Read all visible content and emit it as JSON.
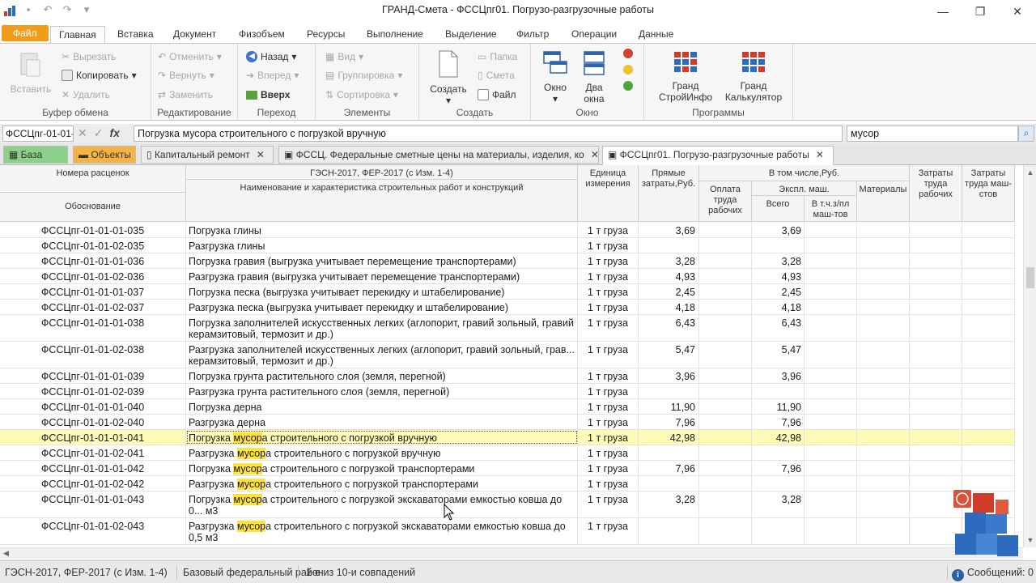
{
  "app": {
    "title": "ГРАНД-Смета - ФССЦпг01. Погрузо-разгрузочные работы",
    "window_controls": [
      "minimize",
      "maximize",
      "close"
    ]
  },
  "ribbon_tabs": [
    "Файл",
    "Главная",
    "Вставка",
    "Документ",
    "Физобъем",
    "Ресурсы",
    "Выполнение",
    "Выделение",
    "Фильтр",
    "Операции",
    "Данные"
  ],
  "ribbon": {
    "clipboard": {
      "title": "Буфер обмена",
      "paste": "Вставить",
      "cut": "Вырезать",
      "copy": "Копировать",
      "delete": "Удалить"
    },
    "editing": {
      "title": "Редактирование",
      "undo": "Отменить",
      "redo": "Вернуть",
      "replace": "Заменить"
    },
    "navigation": {
      "title": "Переход",
      "back": "Назад",
      "forward": "Вперед",
      "up": "Вверх"
    },
    "elements": {
      "title": "Элементы",
      "view": "Вид",
      "grouping": "Группировка",
      "sorting": "Сортировка"
    },
    "create": {
      "title": "Создать",
      "create": "Создать",
      "folder": "Папка",
      "estimate": "Смета",
      "file": "Файл"
    },
    "window": {
      "title": "Окно",
      "window": "Окно",
      "two_windows_line1": "Два",
      "two_windows_line2": "окна"
    },
    "programs": {
      "title": "Программы",
      "grand_stroyinfo_line1": "Гранд",
      "grand_stroyinfo_line2": "СтройИнфо",
      "grand_calc_line1": "Гранд",
      "grand_calc_line2": "Калькулятор"
    }
  },
  "formula_bar": {
    "name_box": "ФССЦпг-01-01-",
    "content": "Погрузка мусора строительного с погрузкой вручную",
    "search": "мусор"
  },
  "doc_tabs": {
    "base": "База",
    "objects": "Объекты",
    "capital_repair": "Капитальный ремонт",
    "fssc": "ФССЦ. Федеральные сметные цены на материалы, изделия, ко",
    "active": "ФССЦпг01. Погрузо-разгрузочные работы"
  },
  "grid": {
    "headers": {
      "code_top": "Номера расценок",
      "code_bottom": "Обоснование",
      "name_top": "ГЭСН-2017, ФЕР-2017 (с Изм. 1-4)",
      "name_bottom": "Наименование и характеристика строительных работ и конструкций",
      "unit": "Единица измерения",
      "direct": "Прямые затраты,Руб.",
      "incl": "В том числе,Руб.",
      "labor_pay": "Оплата труда рабочих",
      "mach": "Экспл. маш.",
      "mach_total": "Всего",
      "mach_incl": "В т.ч.з/пл маш-тов",
      "materials": "Материалы",
      "labor_workers": "Затраты труда рабочих",
      "labor_machinists": "Затраты труда маш-стов"
    },
    "highlight_term": "мусор",
    "rows": [
      {
        "code": "ФССЦпг-01-01-01-035",
        "name": "Погрузка глины",
        "unit": "1 т груза",
        "direct": "3,69",
        "mach": "3,69"
      },
      {
        "code": "ФССЦпг-01-01-02-035",
        "name": "Разгрузка глины",
        "unit": "1 т груза",
        "direct": "",
        "mach": ""
      },
      {
        "code": "ФССЦпг-01-01-01-036",
        "name": "Погрузка гравия (выгрузка учитывает перемещение транспортерами)",
        "unit": "1 т груза",
        "direct": "3,28",
        "mach": "3,28"
      },
      {
        "code": "ФССЦпг-01-01-02-036",
        "name": "Разгрузка гравия (выгрузка учитывает перемещение транспортерами)",
        "unit": "1 т груза",
        "direct": "4,93",
        "mach": "4,93"
      },
      {
        "code": "ФССЦпг-01-01-01-037",
        "name": "Погрузка песка (выгрузка учитывает перекидку и штабелирование)",
        "unit": "1 т груза",
        "direct": "2,45",
        "mach": "2,45"
      },
      {
        "code": "ФССЦпг-01-01-02-037",
        "name": "Разгрузка песка (выгрузка учитывает перекидку и штабелирование)",
        "unit": "1 т груза",
        "direct": "4,18",
        "mach": "4,18"
      },
      {
        "code": "ФССЦпг-01-01-01-038",
        "name": "Погрузка заполнителей искусственных легких (аглопорит, гравий зольный, гравий керамзитовый, термозит и др.)",
        "unit": "1 т груза",
        "direct": "6,43",
        "mach": "6,43"
      },
      {
        "code": "ФССЦпг-01-01-02-038",
        "name": "Разгрузка заполнителей искусственных легких (аглопорит, гравий зольный, грав... керамзитовый, термозит и др.)",
        "unit": "1 т груза",
        "direct": "5,47",
        "mach": "5,47"
      },
      {
        "code": "ФССЦпг-01-01-01-039",
        "name": "Погрузка грунта растительного слоя (земля, перегной)",
        "unit": "1 т груза",
        "direct": "3,96",
        "mach": "3,96"
      },
      {
        "code": "ФССЦпг-01-01-02-039",
        "name": "Разгрузка грунта растительного слоя (земля, перегной)",
        "unit": "1 т груза",
        "direct": "",
        "mach": ""
      },
      {
        "code": "ФССЦпг-01-01-01-040",
        "name": "Погрузка дерна",
        "unit": "1 т груза",
        "direct": "11,90",
        "mach": "11,90"
      },
      {
        "code": "ФССЦпг-01-01-02-040",
        "name": "Разгрузка дерна",
        "unit": "1 т груза",
        "direct": "7,96",
        "mach": "7,96"
      },
      {
        "code": "ФССЦпг-01-01-01-041",
        "name": "Погрузка мусора строительного с погрузкой вручную",
        "unit": "1 т груза",
        "direct": "42,98",
        "mach": "42,98",
        "selected": true
      },
      {
        "code": "ФССЦпг-01-01-02-041",
        "name": "Разгрузка мусора строительного с погрузкой вручную",
        "unit": "1 т груза",
        "direct": "",
        "mach": ""
      },
      {
        "code": "ФССЦпг-01-01-01-042",
        "name": "Погрузка мусора строительного с погрузкой транспортерами",
        "unit": "1 т груза",
        "direct": "7,96",
        "mach": "7,96"
      },
      {
        "code": "ФССЦпг-01-01-02-042",
        "name": "Разгрузка мусора строительного с погрузкой транспортерами",
        "unit": "1 т груза",
        "direct": "",
        "mach": ""
      },
      {
        "code": "ФССЦпг-01-01-01-043",
        "name": "Погрузка мусора строительного с погрузкой экскаваторами емкостью ковша до 0... м3",
        "unit": "1 т груза",
        "direct": "3,28",
        "mach": "3,28"
      },
      {
        "code": "ФССЦпг-01-01-02-043",
        "name": "Разгрузка мусора строительного с погрузкой экскаваторами емкостью ковша до 0,5 м3",
        "unit": "1 т груза",
        "direct": "",
        "mach": ""
      }
    ]
  },
  "status": {
    "norm_base": "ГЭСН-2017, ФЕР-2017 (с Изм. 1-4)",
    "region": "Базовый федеральный район",
    "search_result": "1-е из 10-и совпадений",
    "messages": "Сообщений: 0"
  },
  "colors": {
    "file_tab": "#f39c1a",
    "selected_row": "#fffcb8",
    "search_highlight": "#ffe23a",
    "base_tab": "#8bd18a",
    "objects_tab": "#f5b342"
  }
}
